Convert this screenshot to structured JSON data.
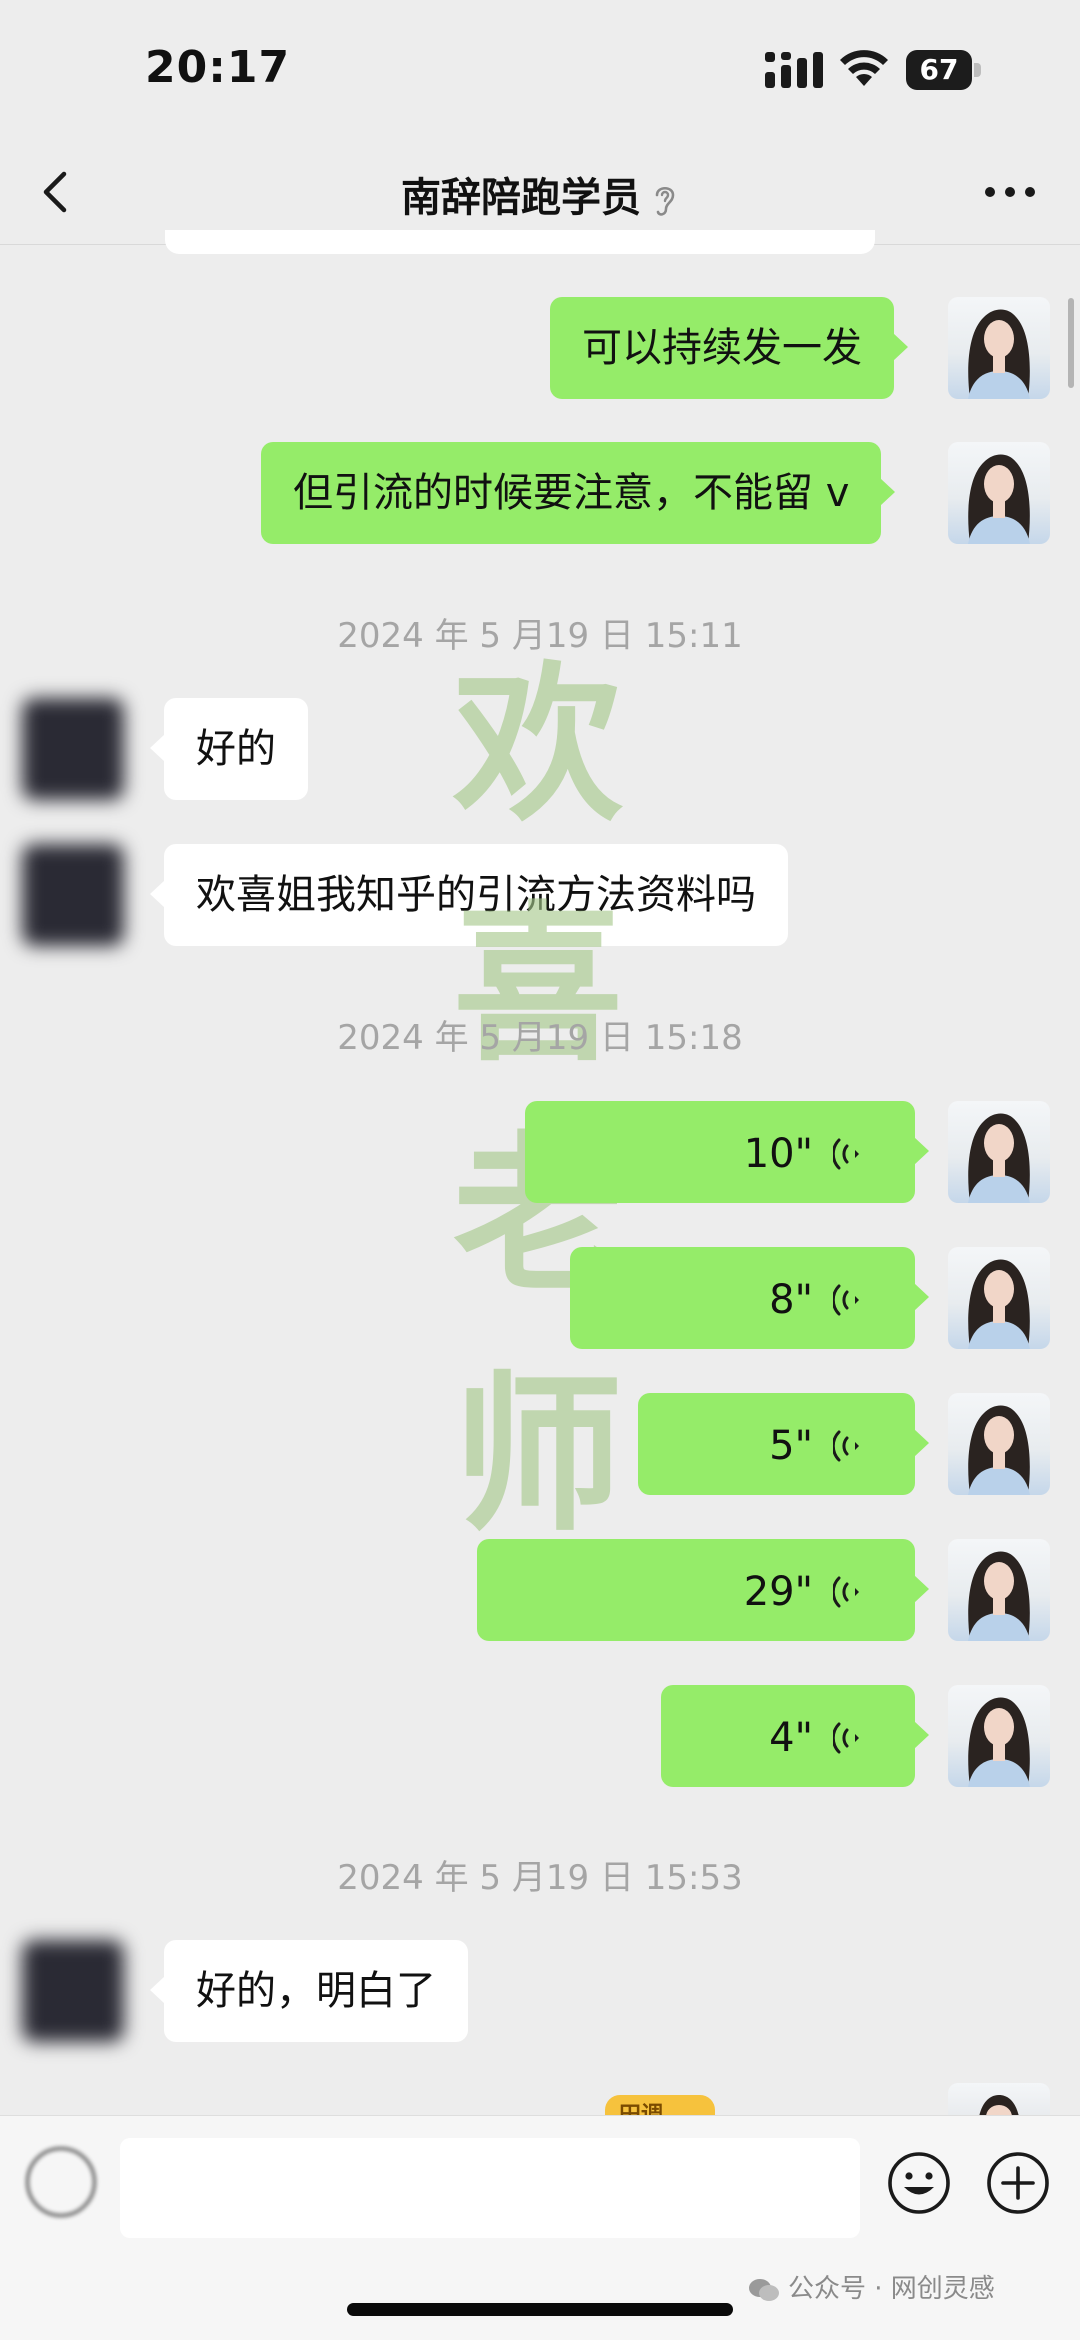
{
  "status_bar": {
    "time": "20:17",
    "battery": "67"
  },
  "nav": {
    "title": "南辞陪跑学员"
  },
  "messages": {
    "m1": "可以持续发一发",
    "m2": "但引流的时候要注意，不能留 v",
    "ts1": "2024 年 5 月19 日 15:11",
    "m3": "好的",
    "m4": "欢喜姐我知乎的引流方法资料吗",
    "ts2": "2024 年 5 月19 日 15:18",
    "v1": "10\"",
    "v2": "8\"",
    "v3": "5\"",
    "v4": "29\"",
    "v5": "4\"",
    "ts3": "2024 年 5 月19 日 15:53",
    "m5": "好的，明白了"
  },
  "watermark": {
    "c1": "欢",
    "c2": "喜",
    "c3": "老",
    "c4": "师"
  },
  "sticker": {
    "text": "田调"
  },
  "input": {
    "placeholder": ""
  },
  "footer": {
    "source": "公众号 · 网创灵感"
  },
  "colors": {
    "me_bubble": "#95ec69",
    "other_bubble": "#ffffff",
    "background": "#ededed",
    "timestamp": "#a5a5a5"
  },
  "icons": [
    "back-arrow-icon",
    "ear-icon",
    "more-icon",
    "voice-wave-icon",
    "voice-input-icon",
    "emoji-icon",
    "plus-icon",
    "wechat-icon"
  ]
}
